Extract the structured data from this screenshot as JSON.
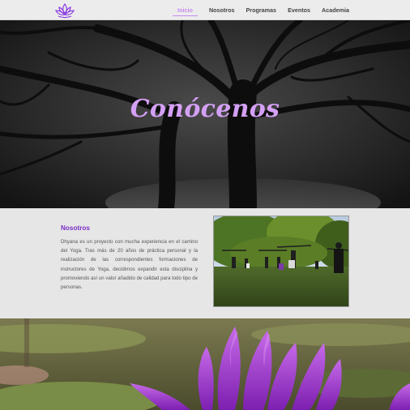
{
  "nav": {
    "logo_icon": "lotus-icon",
    "links": [
      {
        "label": "Inicio",
        "active": true
      },
      {
        "label": "Nosotros",
        "active": false
      },
      {
        "label": "Programas",
        "active": false
      },
      {
        "label": "Eventos",
        "active": false
      },
      {
        "label": "Academia",
        "active": false
      }
    ]
  },
  "hero": {
    "title": "Conócenos"
  },
  "about": {
    "heading": "Nosotros",
    "text": "Dhyana es un proyecto con mucha experiencia en el camino del Yoga. Tras más de 20 años de práctica personal y la realización de las correspondientes formaciones de instructores de Yoga, decidimos expandir esta disciplina y promoviendo así un valor añadido de calidad para todo tipo de personas."
  },
  "colors": {
    "accent": "#c58af0",
    "heading": "#7a2fc6",
    "title": "#d4a0f5"
  }
}
